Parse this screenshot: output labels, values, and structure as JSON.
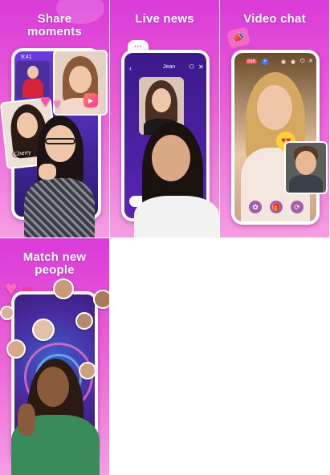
{
  "cards": [
    {
      "title": "Share\nmoments"
    },
    {
      "title": "Live  news"
    },
    {
      "title": "Video chat"
    },
    {
      "title": "Match new\npeople"
    }
  ],
  "share": {
    "status_time": "9:41",
    "name_tag": "Cherry"
  },
  "live": {
    "host_name": "Jean"
  },
  "video": {
    "coin_count": "888"
  },
  "colors": {
    "accent": "#e044d6",
    "deep_purple": "#3a1a8a",
    "pink": "#ff4fa8"
  }
}
